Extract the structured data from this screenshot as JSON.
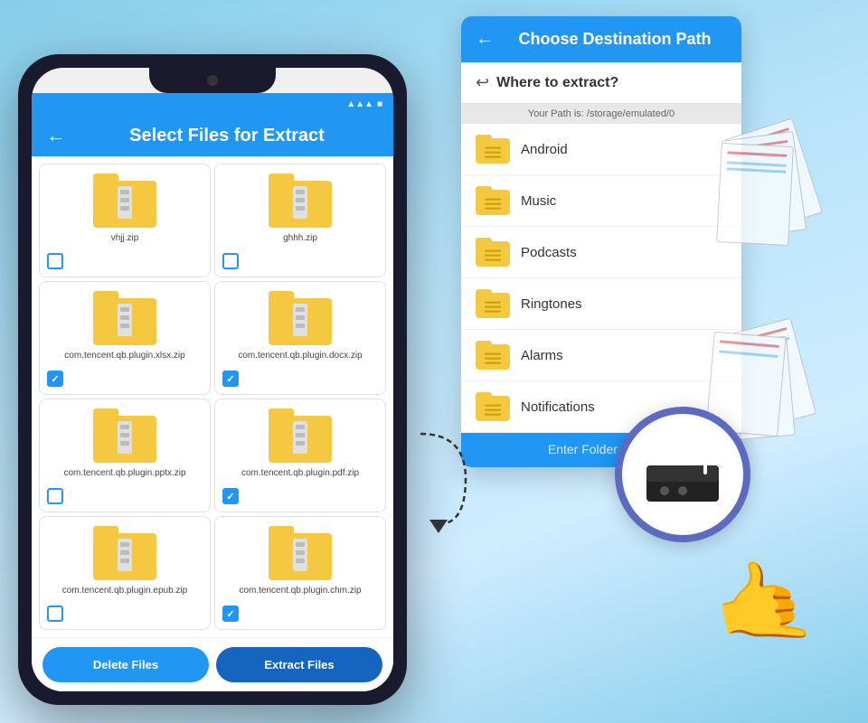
{
  "background": {
    "color_top": "#87ceeb",
    "color_bottom": "#b8e4f9"
  },
  "phone": {
    "status_bar": {
      "signal": "▲▲▲",
      "battery": "■"
    },
    "header": {
      "back_label": "←",
      "title": "Select Files for Extract"
    },
    "files": [
      {
        "name": "vhjj.zip",
        "checked": false
      },
      {
        "name": "ghhh.zip",
        "checked": false
      },
      {
        "name": "com.tencent.qb.plugin.xlsx.zip",
        "checked": true
      },
      {
        "name": "com.tencent.qb.plugin.docx.zip",
        "checked": true
      },
      {
        "name": "com.tencent.qb.plugin.pptx.zip",
        "checked": false
      },
      {
        "name": "com.tencent.qb.plugin.pdf.zip",
        "checked": true
      },
      {
        "name": "com.tencent.qb.plugin.epub.zip",
        "checked": false
      },
      {
        "name": "com.tencent.qb.plugin.chm.zip",
        "checked": true
      }
    ],
    "footer": {
      "delete_label": "Delete Files",
      "extract_label": "Extract Files"
    }
  },
  "destination": {
    "header": {
      "back_label": "←",
      "title": "Choose Destination Path"
    },
    "subheader": {
      "icon": "↩",
      "text": "Where to extract?"
    },
    "path_label": "Your Path is: /storage/emulated/0",
    "folders": [
      {
        "name": "Android"
      },
      {
        "name": "Music"
      },
      {
        "name": "Podcasts"
      },
      {
        "name": "Ringtones"
      },
      {
        "name": "Alarms"
      },
      {
        "name": "Notifications"
      }
    ],
    "folder_input_placeholder": "Enter Folder Name"
  }
}
